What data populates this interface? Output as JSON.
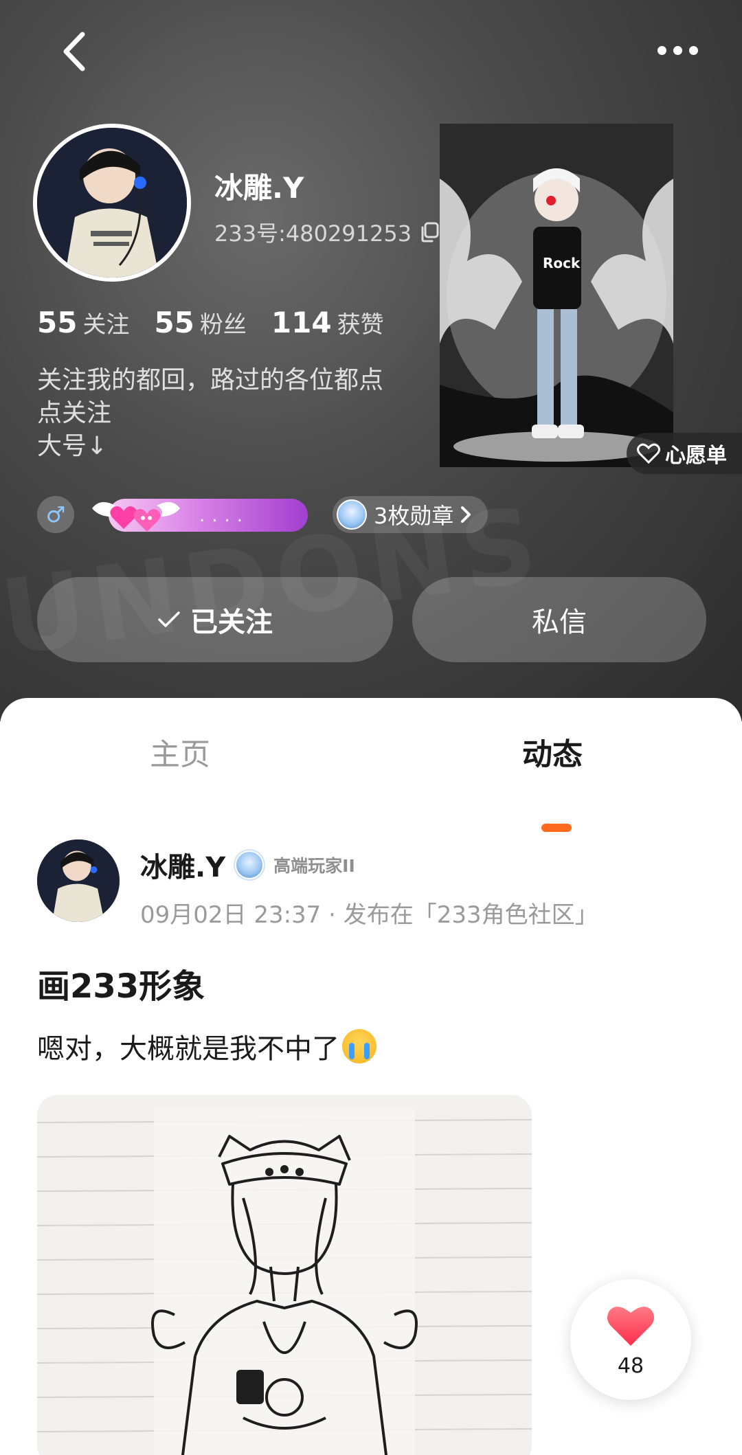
{
  "profile": {
    "nickname": "冰雕.Y",
    "uid": "233号:480291253",
    "bio": "关注我的都回，路过的各位都点\n点关注\n大号↓",
    "stats": [
      {
        "num": "55",
        "label": "关注"
      },
      {
        "num": "55",
        "label": "粉丝"
      },
      {
        "num": "114",
        "label": "获赞"
      }
    ],
    "gender_symbol": "♂",
    "level_dots": "....",
    "medals": "3枚勋章",
    "wishlist": "心愿单"
  },
  "actions": {
    "follow": "已关注",
    "message": "私信"
  },
  "tabs": {
    "home": "主页",
    "feed": "动态"
  },
  "post": {
    "author": "冰雕.Y",
    "rank": "高端玩家II",
    "meta": "09月02日 23:37 · 发布在「233角色社区」",
    "title": "画233形象",
    "body": "嗯对，大概就是我不中了",
    "likes": "48"
  },
  "colors": {
    "accent": "#ff6a1e",
    "like": "#ff4a5e",
    "header_bg": "#3a3a3a"
  }
}
